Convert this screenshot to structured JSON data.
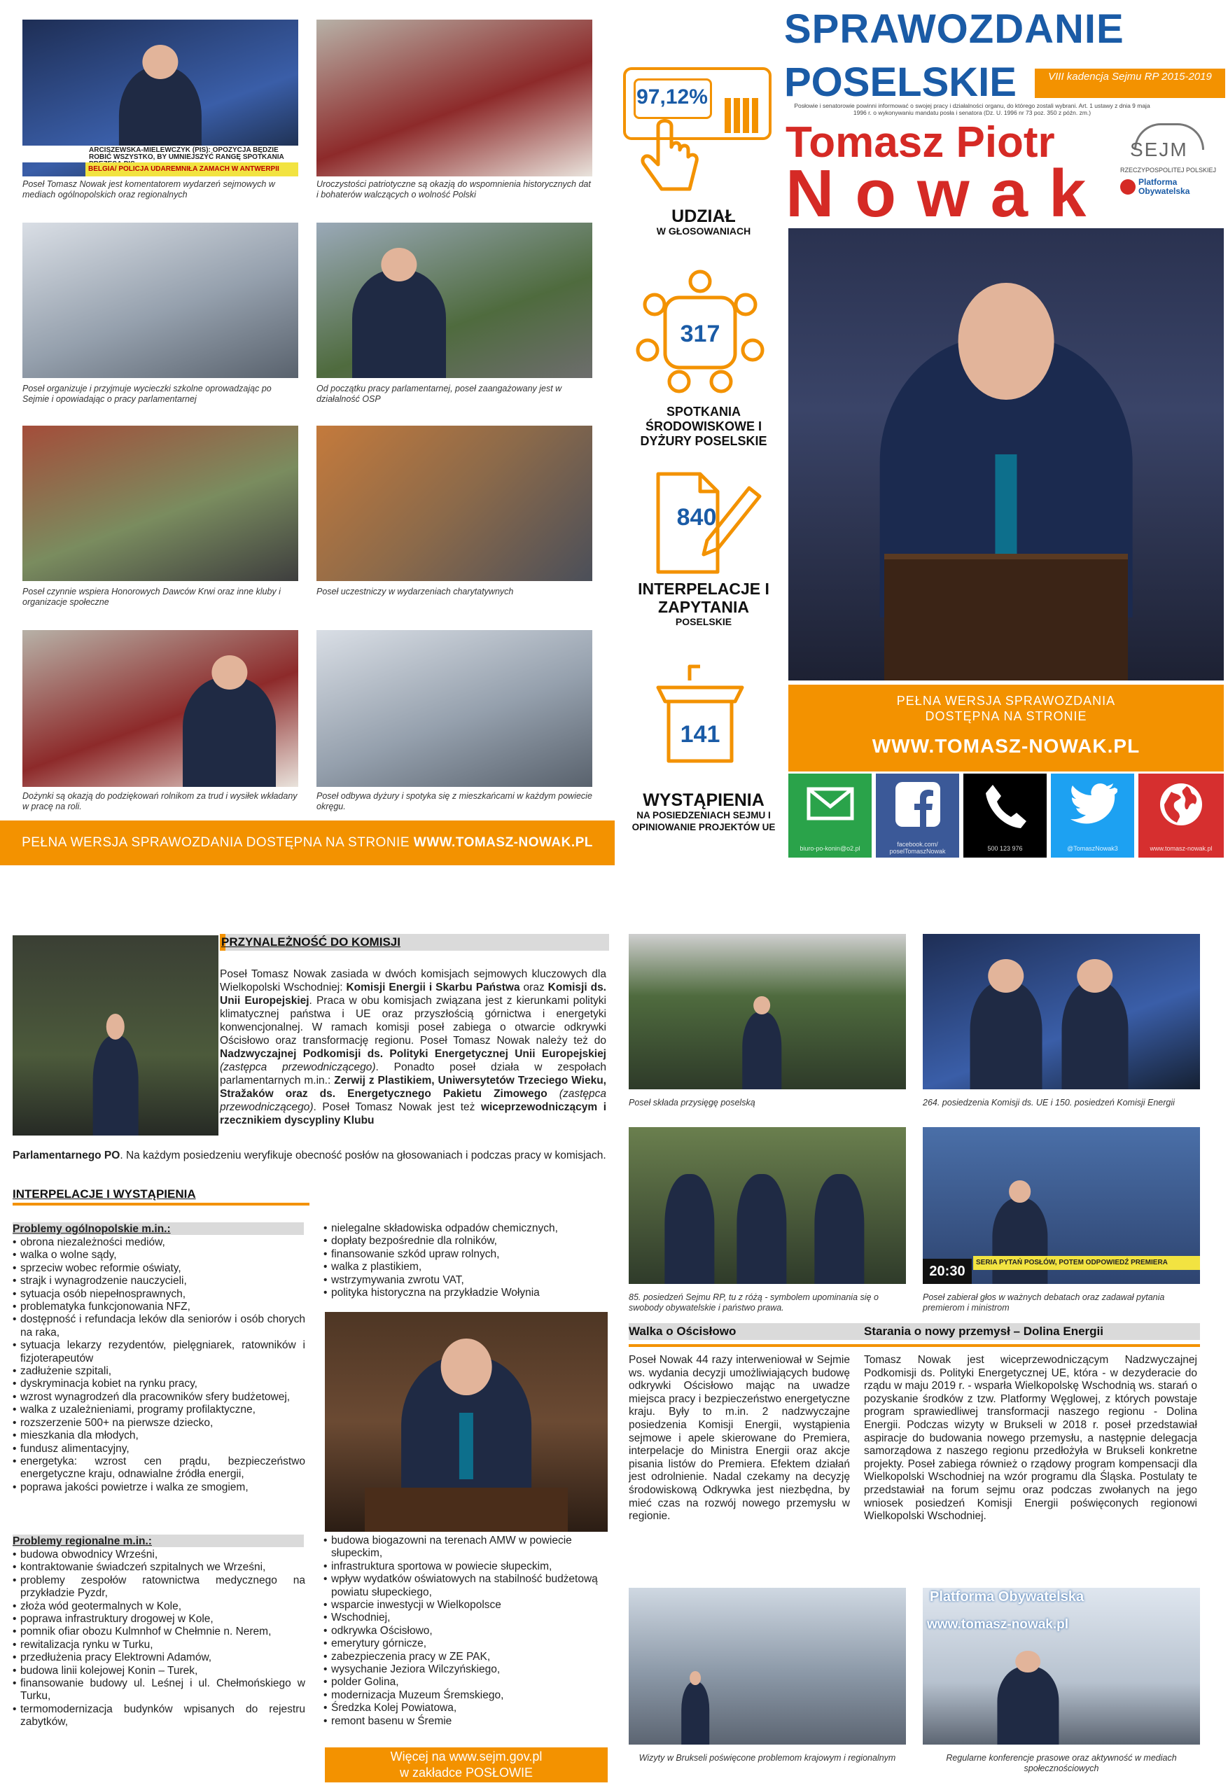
{
  "header": {
    "title_line1": "SPRAWOZDANIE",
    "title_line2": "POSELSKIE",
    "term_badge": "VIII kadencja Sejmu RP 2015-2019",
    "legal_note": "Posłowie i senatorowie powinni informować o swojej pracy i działalności organu, do którego zostali wybrani. Art. 1 ustawy z dnia 9 maja 1996 r. o wykonywaniu mandatu posła i senatora (Dz. U. 1996 nr 73 poz. 350 z późn. zm.)",
    "name_line1": "Tomasz Piotr",
    "name_line2": "Nowak",
    "sejm_logo": "SEJM",
    "sejm_sub": "RZECZYPOSPOLITEJ POLSKIEJ",
    "party": "Platforma Obywatelska"
  },
  "stats": [
    {
      "value": "97,12%",
      "title": "UDZIAŁ",
      "subtitle": "W GŁOSOWANIACH"
    },
    {
      "value": "317",
      "title": "SPOTKANIA ŚRODOWISKOWE I DYŻURY POSELSKIE",
      "subtitle": ""
    },
    {
      "value": "840",
      "title": "INTERPELACJE I ZAPYTANIA",
      "subtitle": "POSELSKIE"
    },
    {
      "value": "141",
      "title": "WYSTĄPIENIA",
      "subtitle": "NA POSIEDZENIACH SEJMU I OPINIOWANIE PROJEKTÓW UE"
    }
  ],
  "website_box": {
    "line1": "PEŁNA WERSJA SPRAWOZDANIA",
    "line2": "DOSTĘPNA NA STRONIE",
    "url": "WWW.TOMASZ-NOWAK.PL"
  },
  "socials": [
    {
      "icon": "mail-icon",
      "label": "biuro-po-konin@o2.pl",
      "color": "#2aa34a"
    },
    {
      "icon": "facebook-icon",
      "label": "facebook.com/ poselTomaszNowak",
      "color": "#3b5998"
    },
    {
      "icon": "phone-icon",
      "label": "500 123 976",
      "color": "#000000"
    },
    {
      "icon": "twitter-icon",
      "label": "@TomaszNowak3",
      "color": "#1da1f2"
    },
    {
      "icon": "globe-icon",
      "label": "www.tomasz-nowak.pl",
      "color": "#d62f2f"
    }
  ],
  "photo_grid": [
    {
      "caption": "Poseł Tomasz Nowak jest komentatorem wydarzeń sejmowych w mediach ogólnopolskich oraz regionalnych",
      "tv_time": "21:00",
      "tv_ticker": "ARCISZEWSKA-MIELEWCZYK (PIS): OPOZYCJA BĘDZIE ROBIĆ WSZYSTKO, BY UMNIEJSZYĆ RANGĘ SPOTKANIA PREZESA PIS",
      "tv_ticker2": "BELGIA/ POLICJA UDAREMNIŁA ZAMACH W ANTWERPII"
    },
    {
      "caption": "Uroczystości patriotyczne są okazją do wspomnienia historycznych dat i bohaterów walczących o wolność Polski"
    },
    {
      "caption": "Poseł organizuje i przyjmuje wycieczki szkolne oprowadzając po Sejmie i opowiadając o pracy parlamentarnej"
    },
    {
      "caption": "Od początku pracy parlamentarnej, poseł zaangażowany jest w działalność OSP"
    },
    {
      "caption": "Poseł czynnie wspiera Honorowych Dawców Krwi oraz inne kluby i organizacje społeczne"
    },
    {
      "caption": "Poseł uczestniczy w wydarzeniach charytatywnych"
    },
    {
      "caption": "Dożynki są okazją do podziękowań rolnikom za trud i wysiłek wkładany w pracę na roli."
    },
    {
      "caption": "Poseł odbywa dyżury i spotyka się z mieszkańcami w każdym powiecie okręgu."
    }
  ],
  "bottom_banner": {
    "text": "PEŁNA WERSJA SPRAWOZDANIA DOSTĘPNA NA STRONIE ",
    "url": "WWW.TOMASZ-NOWAK.PL"
  },
  "committees": {
    "title": "PRZYNALEŻNOŚĆ DO KOMISJI"
  },
  "interpellations": {
    "title": "INTERPELACJE I WYSTĄPIENIA",
    "national_head": "Problemy ogólnopolskie m.in.:",
    "national_items_a": [
      "obrona niezależności mediów,",
      "walka o wolne sądy,",
      "sprzeciw wobec reformie oświaty,",
      "strajk i wynagrodzenie nauczycieli,",
      "sytuacja osób niepełnosprawnych,",
      "problematyka funkcjonowania NFZ,",
      "dostępność i refundacja leków dla seniorów i osób chorych na raka,",
      "sytuacja lekarzy rezydentów, pielęgniarek, ratowników i fizjoterapeutów",
      "zadłużenie szpitali,",
      "dyskryminacja kobiet na rynku pracy,",
      "wzrost wynagrodzeń dla pracowników sfery budżetowej,",
      "walka z uzależnieniami, programy profilaktyczne,",
      "rozszerzenie 500+ na pierwsze dziecko,",
      "mieszkania dla młodych,",
      "fundusz alimentacyjny,",
      "energetyka: wzrost cen prądu, bezpieczeństwo energetyczne kraju, odnawialne źródła energii,",
      "poprawa jakości powietrze i walka ze smogiem,"
    ],
    "national_items_b": [
      "nielegalne składowiska odpadów chemicznych,",
      "dopłaty bezpośrednie dla rolników,",
      "finansowanie szkód upraw rolnych,",
      "walka z plastikiem,",
      "wstrzymywania zwrotu VAT,",
      "polityka historyczna na przykładzie Wołynia"
    ],
    "regional_head": "Problemy regionalne m.in.:",
    "regional_items_a": [
      "budowa obwodnicy Wrześni,",
      "kontraktowanie świadczeń szpitalnych we Wrześni,",
      "problemy zespołów ratownictwa medycznego na przykładzie Pyzdr,",
      "złoża wód geotermalnych w Kole,",
      "poprawa infrastruktury drogowej w Kole,",
      "pomnik ofiar obozu Kulmnhof w Chełmnie n. Nerem,",
      "rewitalizacja rynku w Turku,",
      "przedłużenia pracy Elektrowni Adamów,",
      "budowa linii kolejowej Konin – Turek,",
      "finansowanie budowy ul. Leśnej i ul. Chełmońskiego w Turku,",
      "termomodernizacja budynków wpisanych do rejestru zabytków,"
    ],
    "regional_items_b": [
      "budowa biogazowni na terenach AMW w powiecie słupeckim,",
      "infrastruktura sportowa w powiecie słupeckim,",
      "wpływ wydatków oświatowych na stabilność budżetową powiatu słupeckiego,",
      "wsparcie inwestycji w Wielkopolsce",
      "Wschodniej,",
      "odkrywka Ościsłowo,",
      "emerytury górnicze,",
      "zabezpieczenia pracy w ZE PAK,",
      "wysychanie Jeziora Wilczyńskiego,",
      "polder Golina,",
      "modernizacja Muzeum Śremskiego,",
      "Średzka Kolej Powiatowa,",
      "remont basenu w Śremie"
    ],
    "more_line1": "Więcej na www.sejm.gov.pl",
    "more_line2": "w zakładce POSŁOWIE"
  },
  "right_photos": [
    {
      "caption": "Poseł składa przysięgę poselską"
    },
    {
      "caption": "264. posiedzenia Komisji ds. UE i 150. posiedzeń Komisji Energii"
    },
    {
      "caption": "85. posiedzeń Sejmu RP, tu z różą - symbolem upominania się o swobody obywatelskie i państwo prawa."
    },
    {
      "caption": "Poseł zabierał głos w ważnych debatach oraz zadawał pytania premierom i ministrom",
      "tv_time": "20:30",
      "tv_ticker": "SERIA PYTAŃ POSŁÓW, POTEM ODPOWIEDŹ PREMIERA"
    },
    {
      "caption": "Wizyty w Brukseli poświęcone problemom krajowym i regionalnym"
    },
    {
      "caption": "Regularne konferencje prasowe oraz aktywność w mediach społecznościowych",
      "banner": "Platforma Obywatelska",
      "url": "www.tomasz-nowak.pl"
    }
  ],
  "oscislowo": {
    "title": "Walka o Ościsłowo",
    "text": "Poseł Nowak 44 razy interweniował w Sejmie ws. wydania decyzji umożliwiających budowę odkrywki Ościsłowo mając na uwadze miejsca pracy i bezpieczeństwo energetyczne kraju. Były to m.in. 2 nadzwyczajne posiedzenia Komisji Energii, wystąpienia sejmowe i apele skierowane do Premiera, interpelacje do Ministra Energii oraz akcje pisania listów do Premiera. Efektem działań jest odrolnienie. Nadal czekamy na decyzję środowiskową Odkrywka jest niezbędna, by mieć czas na rozwój nowego przemysłu w regionie."
  },
  "new_industry": {
    "title": "Starania o nowy przemysł  – Dolina Energii",
    "text": "Tomasz Nowak jest wiceprzewodniczącym Nadzwyczajnej Podkomisji ds. Polityki Energetycznej UE, która - w dezyderacie do rządu w maju 2019 r. - wsparła Wielkopolskę Wschodnią ws. starań o pozyskanie środków z tzw. Platformy Węglowej, z których powstaje program sprawiedliwej transformacji naszego regionu - Dolina Energii. Podczas wizyty w Brukseli w 2018 r. poseł przedstawiał aspiracje do budowania nowego przemysłu, a następnie delegacja samorządowa z naszego regionu przedłożyła w Brukseli konkretne projekty. Poseł zabiega również o rządowy program kompensacji dla Wielkopolski Wschodniej na wzór programu dla Śląska. Postulaty te przedstawiał na forum sejmu oraz podczas zwołanych na jego wniosek posiedzeń Komisji Energii poświęconych regionowi Wielkopolski Wschodniej."
  }
}
